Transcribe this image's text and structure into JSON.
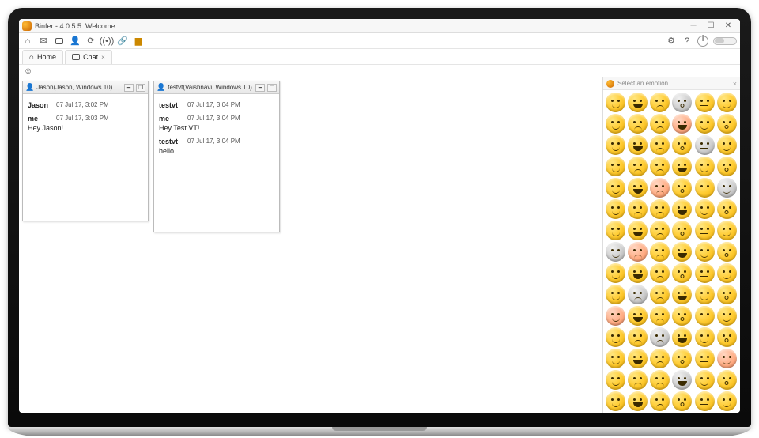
{
  "window": {
    "title": "Binfer - 4.0.5.5. Welcome"
  },
  "tabs": [
    {
      "label": "Home"
    },
    {
      "label": "Chat"
    }
  ],
  "emoji": {
    "title": "Select an emotion",
    "variants": [
      "smile",
      "grin",
      "sad",
      "o",
      "flat",
      "wink",
      "cool",
      "cry",
      "angry",
      "laugh",
      "blush",
      "kiss"
    ]
  },
  "chat_windows": [
    {
      "title": "Jason(Jason, Windows 10)",
      "messages": [
        {
          "who": "Jason",
          "ts": "07 Jul 17, 3:02 PM",
          "text": ""
        },
        {
          "who": "me",
          "ts": "07 Jul 17, 3:03 PM",
          "text": "Hey Jason!"
        }
      ]
    },
    {
      "title": "testvt(Vaishnavi, Windows 10)",
      "messages": [
        {
          "who": "testvt",
          "ts": "07 Jul 17, 3:04 PM",
          "text": ""
        },
        {
          "who": "me",
          "ts": "07 Jul 17, 3:04 PM",
          "text": "Hey Test VT!"
        },
        {
          "who": "testvt",
          "ts": "07 Jul 17, 3:04 PM",
          "text": "hello"
        }
      ]
    }
  ]
}
